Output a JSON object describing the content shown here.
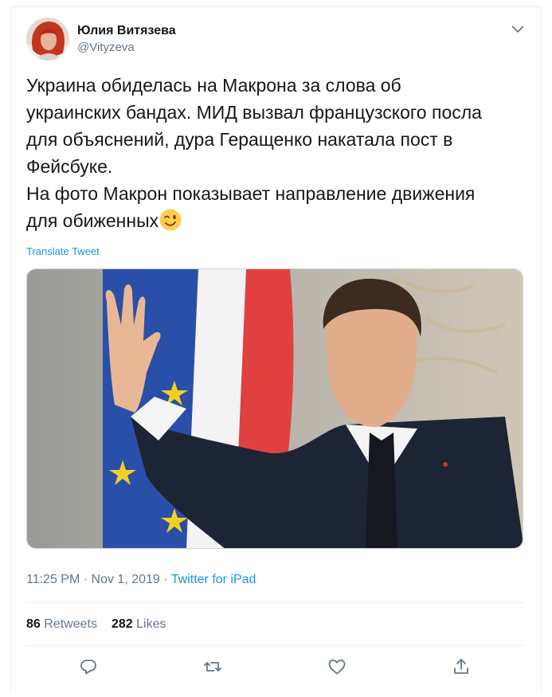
{
  "tweet": {
    "author_name": "Юлия Витязева",
    "author_handle": "@Vityzeva",
    "lines": [
      "Украина обиделась на Макрона за слова об",
      "украинских бандах. МИД вызвал французского посла",
      "для объяснений, дура Геращенко накатала пост в",
      "Фейсбуке.",
      "На фото Макрон показывает направление движения",
      "для обиженных"
    ],
    "emoji": "winking-face",
    "translate_label": "Translate Tweet",
    "time": "11:25 PM",
    "separator": "·",
    "date": "Nov 1, 2019",
    "source": "Twitter for iPad",
    "retweets_count": "86",
    "retweets_label": "Retweets",
    "likes_count": "282",
    "likes_label": "Likes"
  },
  "colors": {
    "link": "#1b95e0",
    "muted": "#657786",
    "text": "#14171a",
    "divider": "#e6ecf0"
  },
  "icons": [
    "chevron-down-icon",
    "reply-icon",
    "retweet-icon",
    "like-icon",
    "share-icon"
  ]
}
